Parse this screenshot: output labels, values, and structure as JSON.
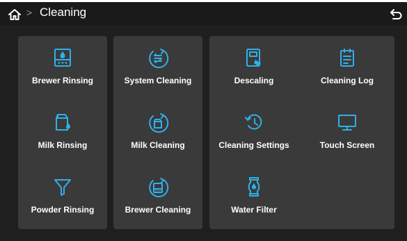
{
  "header": {
    "separator": ">",
    "title": "Cleaning"
  },
  "panels": [
    {
      "tiles": [
        {
          "label": "Brewer Rinsing",
          "icon": "brewer-rinsing-icon"
        },
        {
          "label": "Milk Rinsing",
          "icon": "milk-rinsing-icon"
        },
        {
          "label": "Powder Rinsing",
          "icon": "powder-rinsing-icon"
        }
      ]
    },
    {
      "tiles": [
        {
          "label": "System Cleaning",
          "icon": "system-cleaning-icon"
        },
        {
          "label": "Milk Cleaning",
          "icon": "milk-cleaning-icon"
        },
        {
          "label": "Brewer Cleaning",
          "icon": "brewer-cleaning-icon"
        }
      ]
    },
    {
      "tiles": [
        {
          "label": "Descaling",
          "icon": "descaling-icon"
        },
        {
          "label": "Cleaning Log",
          "icon": "cleaning-log-icon"
        },
        {
          "label": "Cleaning Settings",
          "icon": "cleaning-settings-icon"
        },
        {
          "label": "Touch Screen",
          "icon": "touch-screen-icon"
        },
        {
          "label": "Water Filter",
          "icon": "water-filter-icon"
        }
      ]
    }
  ],
  "colors": {
    "accent": "#2fb0ea",
    "panel": "#3a3a3a",
    "background": "#1f1f1f"
  }
}
